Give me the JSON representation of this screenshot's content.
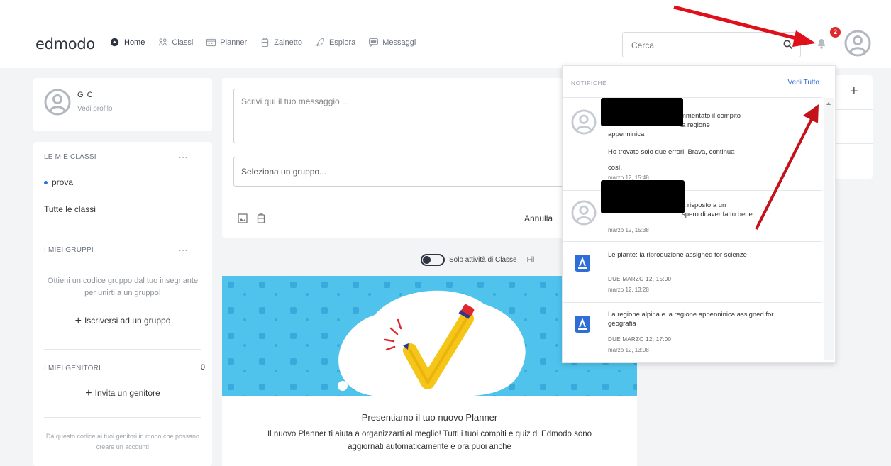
{
  "header": {
    "logo": "edmodo",
    "nav": [
      {
        "label": "Home",
        "icon": "home-icon"
      },
      {
        "label": "Classi",
        "icon": "classes-icon"
      },
      {
        "label": "Planner",
        "icon": "planner-icon"
      },
      {
        "label": "Zainetto",
        "icon": "backpack-icon"
      },
      {
        "label": "Esplora",
        "icon": "rocket-icon"
      },
      {
        "label": "Messaggi",
        "icon": "chat-icon"
      }
    ],
    "search_placeholder": "Cerca",
    "notification_count": "2"
  },
  "profile": {
    "name": "G      C",
    "link": "Vedi profilo"
  },
  "sidebar": {
    "classes_title": "LE MIE CLASSI",
    "classes_menu": "...",
    "class_items": [
      "prova",
      "Tutte le classi"
    ],
    "groups_title": "I MIEI GRUPPI",
    "groups_menu": "...",
    "groups_hint": "Ottieni un codice gruppo dal tuo insegnante per unirti a un gruppo!",
    "groups_action": "Iscriversi ad un gruppo",
    "parents_title": "I MIEI GENITORI",
    "parents_count": "0",
    "parents_action": "Invita un genitore",
    "parents_hint": "Dà questo codice ai tuoi genitori in modo che possano creare un account!"
  },
  "composer": {
    "message_placeholder": "Scrivi qui il tuo messaggio ...",
    "group_select": "Seleziona un gruppo...",
    "cancel": "Annulla"
  },
  "feed": {
    "toggle_label": "Solo attività di Classe",
    "filter_label": "Fil"
  },
  "banner": {
    "title": "Presentiamo il tuo nuovo Planner",
    "text": "Il nuovo Planner ti aiuta a organizzarti al meglio! Tutti i tuoi compiti e quiz di Edmodo sono aggiornati automaticamente e ora puoi anche"
  },
  "notifications": {
    "title": "NOTIFICHE",
    "see_all": "Vedi Tutto",
    "items": [
      {
        "text": "mmentato il compito",
        "text2": "la regione",
        "text3": "appenninica",
        "comment": "Ho trovato solo due errori. Brava, continua così.",
        "time": "marzo 12, 15:48"
      },
      {
        "text": "a risposto a un",
        "text2": "spero di aver fatto bene",
        "time": "marzo 12, 15:38"
      },
      {
        "text": "Le piante: la riproduzione assigned for scienze",
        "due": "DUE MARZO 12, 15:00",
        "time": "marzo 12, 13:28"
      },
      {
        "text": "La regione alpina e la regione appenninica assigned for geografia",
        "due": "DUE MARZO 12, 17:00",
        "time": "marzo 12, 13:08"
      }
    ]
  },
  "colors": {
    "accent": "#2d6fd6",
    "badge": "#e0262f",
    "arrow": "#e0101a",
    "banner_bg": "#4fc3ec"
  }
}
